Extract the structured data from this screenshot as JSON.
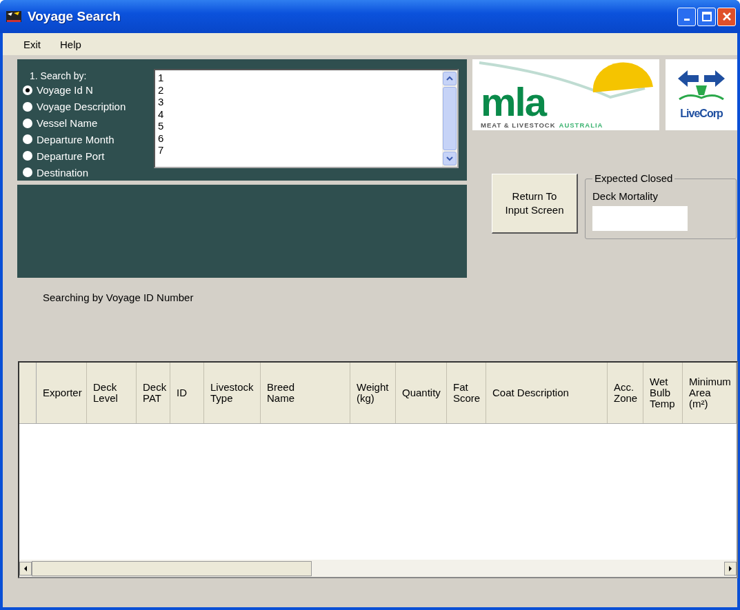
{
  "window": {
    "title": "Voyage Search"
  },
  "menu": [
    "Exit",
    "Help"
  ],
  "search": {
    "heading": "1. Search by:",
    "options": [
      {
        "label": "Voyage  Id N",
        "selected": true
      },
      {
        "label": "Voyage Description",
        "selected": false
      },
      {
        "label": "Vessel Name",
        "selected": false
      },
      {
        "label": "Departure Month",
        "selected": false
      },
      {
        "label": "Departure Port",
        "selected": false
      },
      {
        "label": "Destination",
        "selected": false
      }
    ],
    "list_items": [
      "1",
      "2",
      "3",
      "4",
      "5",
      "6",
      "7"
    ]
  },
  "logos": {
    "mla": {
      "mark": "mla",
      "line_1": "MEAT & LIVESTOCK",
      "line_2": "AUSTRALIA"
    },
    "livecorp": {
      "text": "LiveCorp"
    }
  },
  "return_button": "Return To\nInput Screen",
  "mortality": {
    "group_title": "Expected Closed",
    "label": "Deck Mortality"
  },
  "status": "Searching by Voyage ID Number",
  "table": {
    "columns": [
      {
        "label": "Exporter"
      },
      {
        "label": "Deck\nLevel"
      },
      {
        "label": "Deck\nPAT"
      },
      {
        "label": "ID"
      },
      {
        "label": "Livestock\nType"
      },
      {
        "label": "Breed\nName"
      },
      {
        "label": "Weight\n(kg)"
      },
      {
        "label": "Quantity"
      },
      {
        "label": "Fat\nScore"
      },
      {
        "label": "Coat Description"
      },
      {
        "label": "Acc.\nZone"
      },
      {
        "label": "Wet\nBulb\nTemp"
      },
      {
        "label": "Minimum\nArea\n(m²)"
      }
    ]
  }
}
